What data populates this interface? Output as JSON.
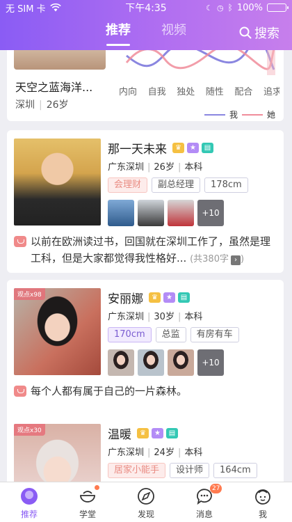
{
  "status_bar": {
    "carrier": "无 SIM 卡",
    "time": "下午4:35",
    "battery": "100%"
  },
  "header": {
    "tabs": [
      {
        "label": "推荐"
      },
      {
        "label": "视频"
      }
    ],
    "search_label": "搜索"
  },
  "card0": {
    "name": "天空之蓝海洋...",
    "city": "深圳",
    "age": "26岁",
    "chart_data": {
      "type": "line",
      "categories": [
        "内向",
        "自我",
        "独处",
        "随性",
        "配合",
        "追求"
      ],
      "series": [
        {
          "name": "我",
          "color": "#8a86e0"
        },
        {
          "name": "她",
          "color": "#f08c9a"
        }
      ]
    }
  },
  "profiles": [
    {
      "name": "那一天未来",
      "views": "",
      "location": "广东深圳",
      "age": "26岁",
      "education": "本科",
      "tags": [
        "会理财",
        "副总经理",
        "178cm"
      ],
      "more_photos": "+10",
      "bio": "以前在欧洲读过书，回国就在深圳工作了，虽然是理工科，但是大家都觉得我性格好...",
      "bio_count": "(共380字",
      "bio_arrow": "›",
      "bio_close": ")"
    },
    {
      "name": "安丽娜",
      "views": "观点x98",
      "location": "广东深圳",
      "age": "30岁",
      "education": "本科",
      "tags": [
        "170cm",
        "总监",
        "有房有车"
      ],
      "more_photos": "+10",
      "bio": "每个人都有属于自己的一片森林。"
    },
    {
      "name": "温暖",
      "views": "观点x30",
      "location": "广东深圳",
      "age": "24岁",
      "education": "本科",
      "tags": [
        "居家小能手",
        "设计师",
        "164cm"
      ]
    }
  ],
  "bottom_nav": {
    "items": [
      {
        "label": "推荐"
      },
      {
        "label": "学堂"
      },
      {
        "label": "发现"
      },
      {
        "label": "消息",
        "badge": "27"
      },
      {
        "label": "我"
      }
    ]
  },
  "colors": {
    "accent": "#8a5cf4",
    "pink_tag": "#e98b82",
    "purple_tag": "#7a5cd1"
  }
}
